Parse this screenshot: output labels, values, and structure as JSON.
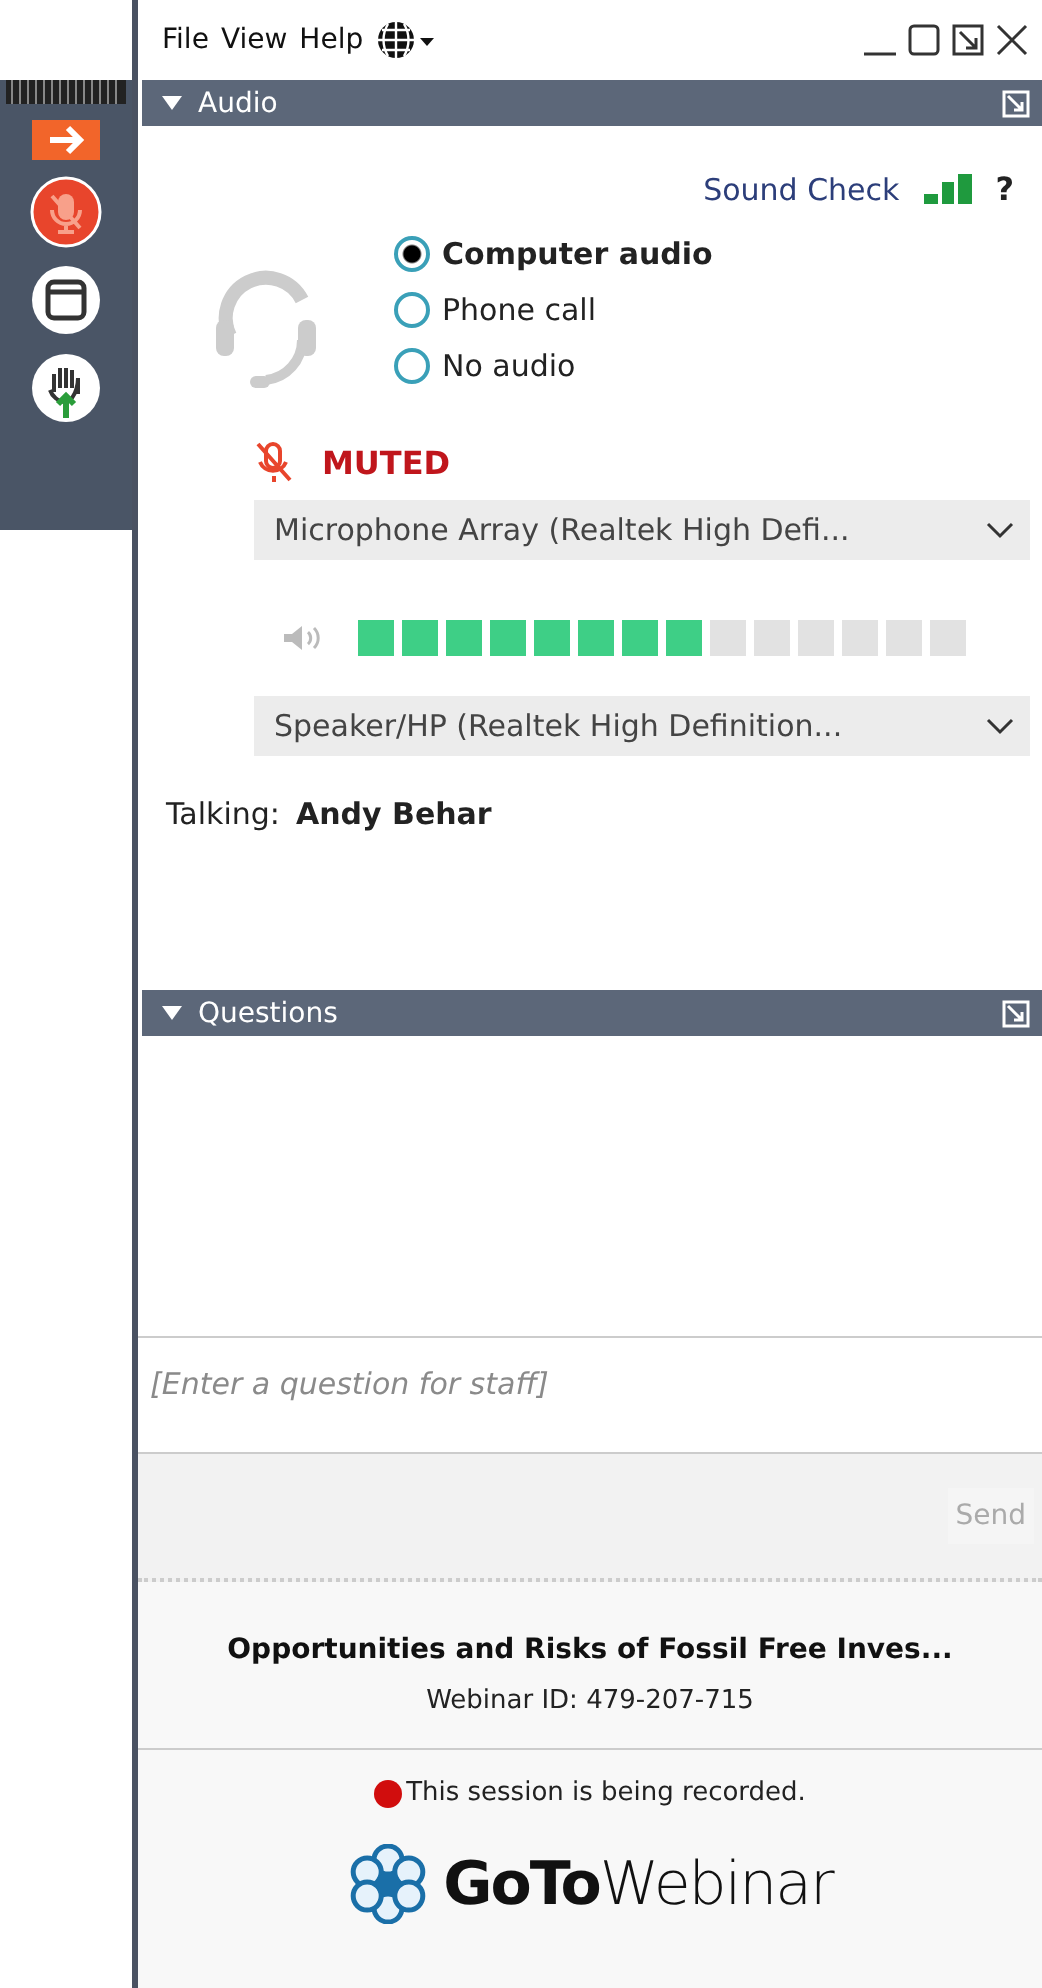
{
  "menu": [
    "File",
    "View",
    "Help"
  ],
  "audio": {
    "title": "Audio",
    "sound_check": "Sound Check",
    "help": "?",
    "options": [
      {
        "label": "Computer audio",
        "selected": true
      },
      {
        "label": "Phone call",
        "selected": false
      },
      {
        "label": "No audio",
        "selected": false
      }
    ],
    "mic_status": "MUTED",
    "microphone": "Microphone Array (Realtek High Defi...",
    "speaker_meter": {
      "level": 0.5714
    },
    "speaker": "Speaker/HP (Realtek High Definition...",
    "talking_label": "Talking:",
    "talking_name": "Andy Behar"
  },
  "questions": {
    "title": "Questions",
    "placeholder": "[Enter a question for staff]",
    "send": "Send"
  },
  "webinar": {
    "title": "Opportunities and Risks of Fossil Free Inves...",
    "id": "Webinar ID: 479-207-715",
    "recording": "This session is being recorded.",
    "logo": "**GoTo**Webinar"
  }
}
